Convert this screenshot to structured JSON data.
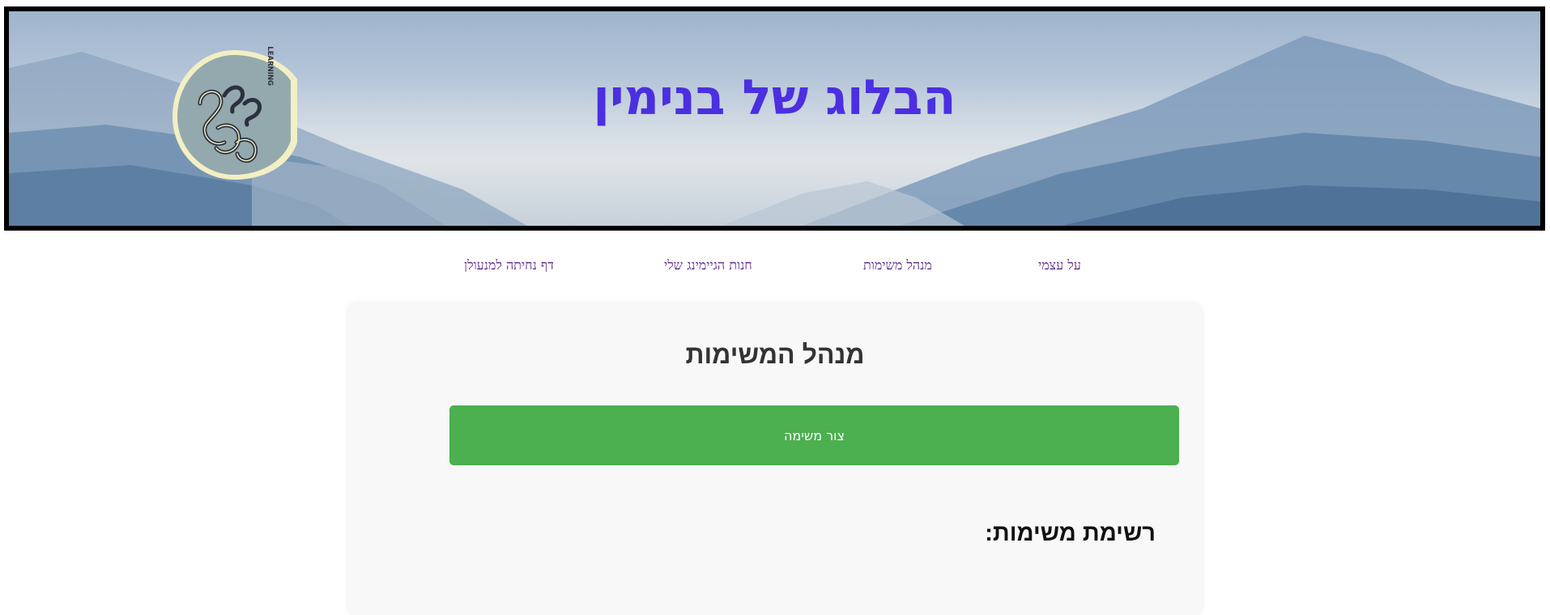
{
  "header": {
    "title": "הבלוג של בנימין",
    "logo_text": "SELF-DIRECTED LEARNING"
  },
  "nav": {
    "items": [
      {
        "label": "על עצמי"
      },
      {
        "label": "מנהל משימות"
      },
      {
        "label": "חנות הגיימינג שלי"
      },
      {
        "label": "דף נחיתה למנעולן"
      }
    ]
  },
  "task_manager": {
    "title": "מנהל המשימות",
    "create_button_label": "צור משימה",
    "list_heading": "רשימת משימות:"
  },
  "colors": {
    "title": "#4b2fe0",
    "nav_link": "#5b2a86",
    "button": "#4caf50",
    "card_bg": "#f8f8f8"
  }
}
